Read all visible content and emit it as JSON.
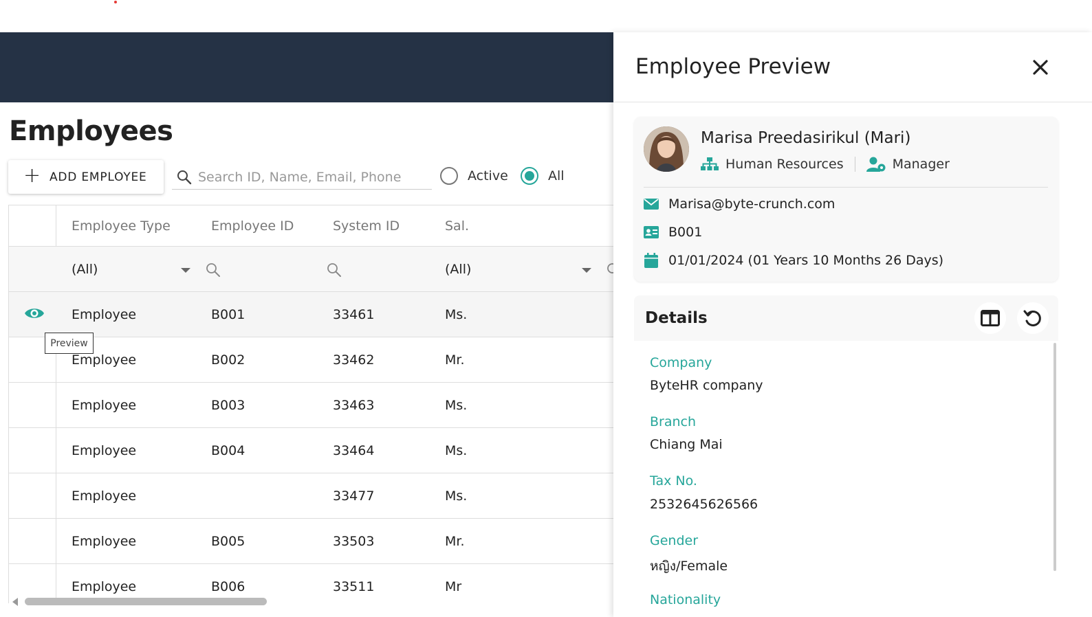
{
  "page": {
    "title": "Employees",
    "add_button_label": "ADD EMPLOYEE",
    "search_placeholder": "Search ID, Name, Email, Phone",
    "filter_active_label": "Active",
    "filter_all_label": "All",
    "selected_filter": "All",
    "accent_color": "#26a69a",
    "navbar_color": "#253245"
  },
  "grid": {
    "columns": [
      "Employee Type",
      "Employee ID",
      "System ID",
      "Sal."
    ],
    "filters": [
      "(All)",
      "",
      "",
      "(All)"
    ],
    "rows": [
      {
        "type": "Employee",
        "id": "B001",
        "sys": "33461",
        "sal": "Ms."
      },
      {
        "type": "Employee",
        "id": "B002",
        "sys": "33462",
        "sal": "Mr."
      },
      {
        "type": "Employee",
        "id": "B003",
        "sys": "33463",
        "sal": "Ms."
      },
      {
        "type": "Employee",
        "id": "B004",
        "sys": "33464",
        "sal": "Ms."
      },
      {
        "type": "Employee",
        "id": "",
        "sys": "33477",
        "sal": "Ms."
      },
      {
        "type": "Employee",
        "id": "B005",
        "sys": "33503",
        "sal": "Mr."
      },
      {
        "type": "Employee",
        "id": "B006",
        "sys": "33511",
        "sal": "Mr"
      }
    ],
    "tooltip": "Preview"
  },
  "panel": {
    "title": "Employee Preview",
    "name": "Marisa Preedasirikul (Mari)",
    "department": "Human Resources",
    "position": "Manager",
    "email": "Marisa@byte-crunch.com",
    "employee_id": "B001",
    "start_date": "01/01/2024 (01 Years 10 Months 26 Days)",
    "details_title": "Details",
    "fields": [
      {
        "label": "Company",
        "value": "ByteHR company"
      },
      {
        "label": "Branch",
        "value": "Chiang Mai"
      },
      {
        "label": "Tax No.",
        "value": "2532645626566"
      },
      {
        "label": "Gender",
        "value": "หญิง/Female"
      },
      {
        "label": "Nationality",
        "value": ""
      }
    ]
  }
}
